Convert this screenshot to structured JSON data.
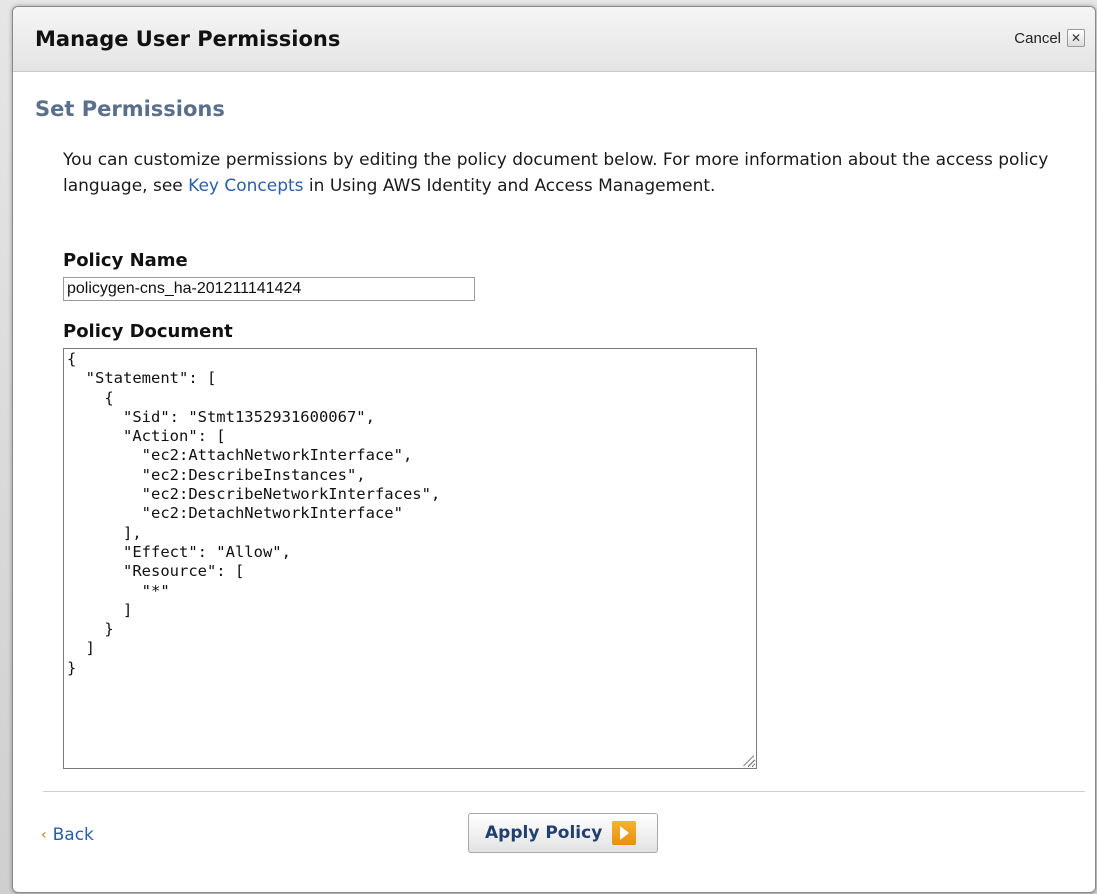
{
  "dialog": {
    "title": "Manage User Permissions",
    "cancel_label": "Cancel",
    "cancel_icon": "close-icon"
  },
  "section": {
    "title": "Set Permissions"
  },
  "intro": {
    "text_before": "You can customize permissions by editing the policy document below. For more information about the access policy language, see ",
    "link_text": "Key Concepts",
    "text_after": " in Using AWS Identity and Access Management."
  },
  "policy_name": {
    "label": "Policy Name",
    "value": "policygen-cns_ha-201211141424"
  },
  "policy_document": {
    "label": "Policy Document",
    "value": "{\n  \"Statement\": [\n    {\n      \"Sid\": \"Stmt1352931600067\",\n      \"Action\": [\n        \"ec2:AttachNetworkInterface\",\n        \"ec2:DescribeInstances\",\n        \"ec2:DescribeNetworkInterfaces\",\n        \"ec2:DetachNetworkInterface\"\n      ],\n      \"Effect\": \"Allow\",\n      \"Resource\": [\n        \"*\"\n      ]\n    }\n  ]\n}"
  },
  "footer": {
    "back_label": "Back",
    "back_icon": "chevron-left-icon",
    "apply_label": "Apply Policy",
    "apply_icon": "play-arrow-icon"
  },
  "colors": {
    "section_title": "#5a6f8c",
    "link": "#2a5fa8",
    "apply_icon": "#f0a020"
  }
}
